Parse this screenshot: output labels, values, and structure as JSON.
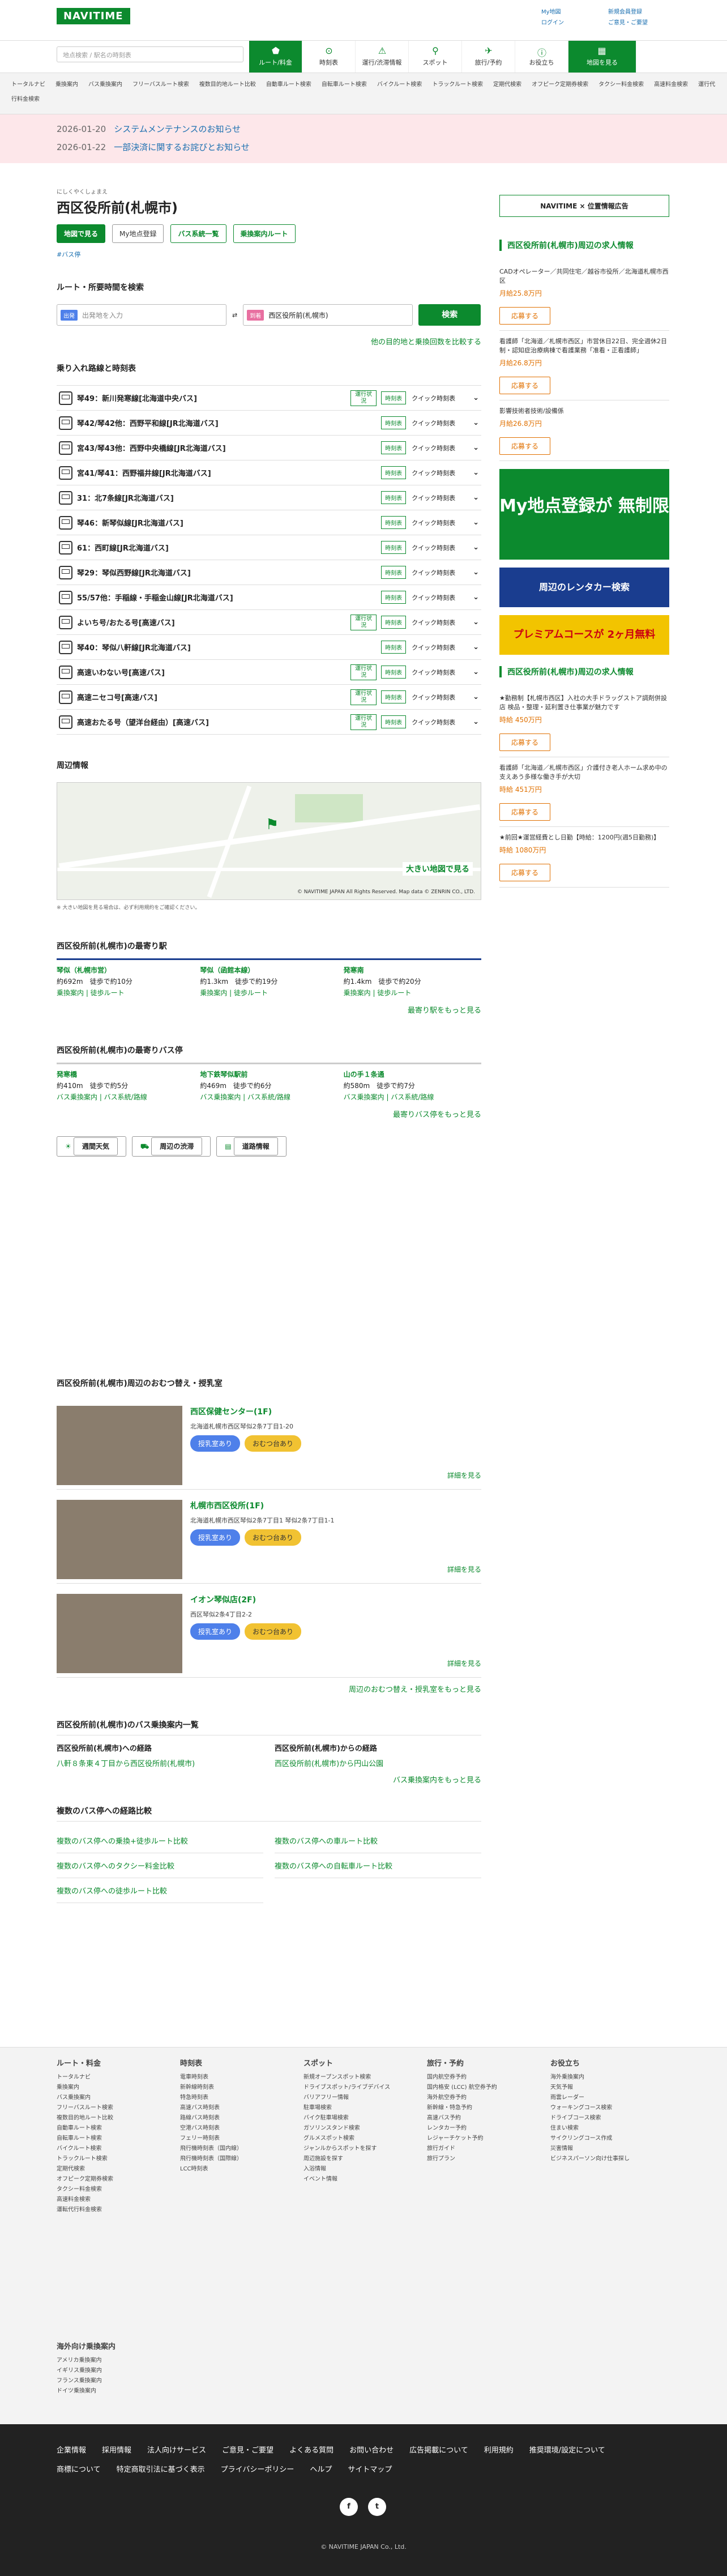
{
  "header": {
    "logo": "NAVITIME",
    "search_placeholder": "地点検索 / 駅名の時刻表",
    "links": [
      "My地図",
      "ログイン",
      "新規会員登録",
      "ご意見・ご要望"
    ]
  },
  "nav": [
    {
      "label": "ルート/料金"
    },
    {
      "label": "時刻表"
    },
    {
      "label": "運行/渋滞情報"
    },
    {
      "label": "スポット"
    },
    {
      "label": "旅行/予約"
    },
    {
      "label": "お役立ち"
    },
    {
      "label": "地図を見る"
    }
  ],
  "subnav": [
    "トータルナビ",
    "乗換案内",
    "バス乗換案内",
    "フリーバスルート検索",
    "複数目的地ルート比較",
    "自動車ルート検索",
    "自転車ルート検索",
    "バイクルート検索",
    "トラックルート検索",
    "定期代検索",
    "オフピーク定期券検索",
    "タクシー料金検索",
    "高速料金検索",
    "運行代行料金検索"
  ],
  "notices": [
    {
      "date": "2026-01-20",
      "text": "システムメンテナンスのお知らせ"
    },
    {
      "date": "2026-01-22",
      "text": "一部決済に関するお詫びとお知らせ"
    }
  ],
  "station": {
    "ruby": "にしくやくしょまえ",
    "name": "西区役所前(札幌市)",
    "buttons": [
      "地図で見る",
      "My地点登録",
      "バス系統一覧",
      "乗換案内ルート"
    ],
    "tag": "#バス停"
  },
  "route": {
    "heading": "ルート・所要時間を検索",
    "from_tag": "出発",
    "from_placeholder": "出発地を入力",
    "to_tag": "到着",
    "to_value": "西区役所前(札幌市)",
    "search": "検索",
    "compare": "他の目的地と乗換回数を比較する"
  },
  "lines_heading": "乗り入れ路線と時刻表",
  "lines": [
    {
      "name": "琴49：新川発寒線[北海道中央バス]",
      "info": "運行状況",
      "tt": "時刻表",
      "qk": "クイック時刻表"
    },
    {
      "name": "琴42/琴42他：西野平和線[JR北海道バス]",
      "info": "",
      "tt": "時刻表",
      "qk": "クイック時刻表"
    },
    {
      "name": "宮43/琴43他：西野中央橋線[JR北海道バス]",
      "info": "",
      "tt": "時刻表",
      "qk": "クイック時刻表"
    },
    {
      "name": "宮41/琴41：西野福井線[JR北海道バス]",
      "info": "",
      "tt": "時刻表",
      "qk": "クイック時刻表"
    },
    {
      "name": "31：北7条線[JR北海道バス]",
      "info": "",
      "tt": "時刻表",
      "qk": "クイック時刻表"
    },
    {
      "name": "琴46：新琴似線[JR北海道バス]",
      "info": "",
      "tt": "時刻表",
      "qk": "クイック時刻表"
    },
    {
      "name": "61：西町線[JR北海道バス]",
      "info": "",
      "tt": "時刻表",
      "qk": "クイック時刻表"
    },
    {
      "name": "琴29：琴似西野線[JR北海道バス]",
      "info": "",
      "tt": "時刻表",
      "qk": "クイック時刻表"
    },
    {
      "name": "55/57他：手稲線・手稲金山線[JR北海道バス]",
      "info": "",
      "tt": "時刻表",
      "qk": "クイック時刻表"
    },
    {
      "name": "よいち号/おたる号[高速バス]",
      "info": "運行状況",
      "tt": "時刻表",
      "qk": "クイック時刻表"
    },
    {
      "name": "琴40：琴似八軒線[JR北海道バス]",
      "info": "",
      "tt": "時刻表",
      "qk": "クイック時刻表"
    },
    {
      "name": "高速いわない号[高速バス]",
      "info": "運行状況",
      "tt": "時刻表",
      "qk": "クイック時刻表"
    },
    {
      "name": "高速ニセコ号[高速バス]",
      "info": "運行状況",
      "tt": "時刻表",
      "qk": "クイック時刻表"
    },
    {
      "name": "高速おたる号（望洋台経由）[高速バス]",
      "info": "運行状況",
      "tt": "時刻表",
      "qk": "クイック時刻表"
    }
  ],
  "map": {
    "heading": "周辺情報",
    "link": "大きい地図で見る",
    "copy": "© NAVITIME JAPAN All Rights Reserved. Map data © ZENRIN CO., LTD.",
    "note": "※ 大きい地図を見る場合は、必ず利用規約をご確認ください。"
  },
  "near_stations": {
    "heading": "西区役所前(札幌市)の最寄り駅",
    "items": [
      {
        "name": "琴似（札幌市営）",
        "dist": "約692m　徒歩で約10分",
        "links": "乗換案内 | 徒歩ルート"
      },
      {
        "name": "琴似（函館本線）",
        "dist": "約1.3km　徒歩で約19分",
        "links": "乗換案内 | 徒歩ルート"
      },
      {
        "name": "発寒南",
        "dist": "約1.4km　徒歩で約20分",
        "links": "乗換案内 | 徒歩ルート"
      }
    ],
    "more": "最寄り駅をもっと見る"
  },
  "near_bus": {
    "heading": "西区役所前(札幌市)の最寄りバス停",
    "items": [
      {
        "name": "発寒橋",
        "dist": "約410m　徒歩で約5分",
        "links": "バス乗換案内 | バス系統/路線"
      },
      {
        "name": "地下鉄琴似駅前",
        "dist": "約469m　徒歩で約6分",
        "links": "バス乗換案内 | バス系統/路線"
      },
      {
        "name": "山の手１条通",
        "dist": "約580m　徒歩で約7分",
        "links": "バス乗換案内 | バス系統/路線"
      }
    ],
    "more": "最寄りバス停をもっと見る"
  },
  "weather_buttons": [
    "週間天気",
    "周辺の渋滞",
    "道路情報"
  ],
  "nursing": {
    "heading": "西区役所前(札幌市)周辺のおむつ替え・授乳室",
    "items": [
      {
        "name": "西区保健センター(1F)",
        "addr": "北海道札幌市西区琴似2条7丁目1-20",
        "p1": "授乳室あり",
        "p2": "おむつ台あり",
        "detail": "詳細を見る"
      },
      {
        "name": "札幌市西区役所(1F)",
        "addr": "北海道札幌市西区琴似2条7丁目1 琴似2条7丁目1-1",
        "p1": "授乳室あり",
        "p2": "おむつ台あり",
        "detail": "詳細を見る"
      },
      {
        "name": "イオン琴似店(2F)",
        "addr": "西区琴似2条4丁目2-2",
        "p1": "授乳室あり",
        "p2": "おむつ台あり",
        "detail": "詳細を見る"
      }
    ],
    "more": "周辺のおむつ替え・授乳室をもっと見る"
  },
  "bus_route": {
    "heading": "西区役所前(札幌市)のバス乗換案内一覧",
    "to_title": "西区役所前(札幌市)への経路",
    "to_item": "八軒８条東４丁目から西区役所前(札幌市)",
    "from_title": "西区役所前(札幌市)からの経路",
    "from_item": "西区役所前(札幌市)から円山公園",
    "more": "バス乗換案内をもっと見る"
  },
  "multi": {
    "heading": "複数のバス停への経路比較",
    "items": [
      "複数のバス停への乗換+徒歩ルート比較",
      "複数のバス停への車ルート比較",
      "複数のバス停へのタクシー料金比較",
      "複数のバス停への自転車ルート比較",
      "複数のバス停への徒歩ルート比較"
    ]
  },
  "side": {
    "ad_title": "NAVITIME × 位置情報広告",
    "jobs_title": "西区役所前(札幌市)周辺の求人情報",
    "jobs": [
      {
        "text": "CADオペレーター／共同住宅／越谷市役所／北海道札幌市西区",
        "pay": "月給25.8万円",
        "apply": "応募する"
      },
      {
        "text": "看護師「北海道／札幌市西区」市営休日22日、完全週休2日制・認知症治療病棟で看護業務「准看・正看護師」",
        "pay": "月給26.8万円",
        "apply": "応募する"
      },
      {
        "text": "影響技術者技術/設備係",
        "pay": "月給26.8万円",
        "apply": "応募する"
      }
    ],
    "ad1": "My地点登録が 無制限",
    "ad2": "周辺のレンタカー検索",
    "ad3": "プレミアムコースが 2ヶ月無料",
    "jobs2_title": "西区役所前(札幌市)周辺の求人情報",
    "jobs2": [
      {
        "text": "★勤務制【札幌市西区】入社の大手ドラッグストア調剤併設店 検品・整理・延利置き仕事業が魅力です",
        "pay": "時給 450万円",
        "apply": "応募する"
      },
      {
        "text": "看護師「北海道／札幌市西区」介護付き老人ホーム求め中の支えあう多様な働き手が大切",
        "pay": "時給 451万円",
        "apply": "応募する"
      },
      {
        "text": "★前回★運営経費とし日勤【時給：1200円(週5日勤務)】",
        "pay": "時給 1080万円",
        "apply": "応募する"
      }
    ]
  },
  "footer": {
    "cols": [
      {
        "title": "ルート・料金",
        "items": [
          "トータルナビ",
          "乗換案内",
          "バス乗換案内",
          "フリーバスルート検索",
          "複数目的地ルート比較",
          "自動車ルート検索",
          "自転車ルート検索",
          "バイクルート検索",
          "トラックルート検索",
          "定期代検索",
          "オフピーク定期券検索",
          "タクシー料金検索",
          "高速料金検索",
          "運転代行料金検索"
        ]
      },
      {
        "title": "時刻表",
        "items": [
          "電車時刻表",
          "新幹線時刻表",
          "特急時刻表",
          "高速バス時刻表",
          "路線バス時刻表",
          "空港バス時刻表",
          "フェリー時刻表",
          "飛行機時刻表（国内線）",
          "飛行機時刻表（国際線）",
          "LCC時刻表"
        ]
      },
      {
        "title": "スポット",
        "items": [
          "新規オープンスポット検索",
          "ドライブスポット/ライブデバイス",
          "バリアフリー情報",
          "駐車場検索",
          "バイク駐車場検索",
          "ガソリンスタンド検索",
          "グルメスポット検索",
          "ジャンルからスポットを探す",
          "周辺施設を探す",
          "入浴情報",
          "イベント情報"
        ]
      },
      {
        "title": "旅行・予約",
        "items": [
          "国内航空券予約",
          "国内格安 (LCC) 航空券予約",
          "海外航空券予約",
          "新幹線・特急予約",
          "高速バス予約",
          "レンタカー予約",
          "レジャーチケット予約",
          "旅行ガイド",
          "旅行プラン"
        ]
      },
      {
        "title": "お役立ち",
        "items": [
          "海外乗換案内",
          "天気予報",
          "雨雲レーダー",
          "ウォーキングコース検索",
          "ドライブコース検索",
          "住まい検索",
          "サイクリングコース作成",
          "災害情報",
          "ビジネスパーソン向け仕事探し"
        ]
      }
    ],
    "overseas_title": "海外向け乗換案内",
    "overseas": [
      "アメリカ乗換案内",
      "イギリス乗換案内",
      "フランス乗換案内",
      "ドイツ乗換案内"
    ],
    "bottom": [
      "企業情報",
      "採用情報",
      "法人向けサービス",
      "ご意見・ご要望",
      "よくある質問",
      "お問い合わせ",
      "広告掲載について",
      "利用規約",
      "推奨環境/設定について",
      "商標について",
      "特定商取引法に基づく表示",
      "プライバシーポリシー",
      "ヘルプ",
      "サイトマップ"
    ],
    "copyright": "© NAVITIME JAPAN Co., Ltd."
  }
}
